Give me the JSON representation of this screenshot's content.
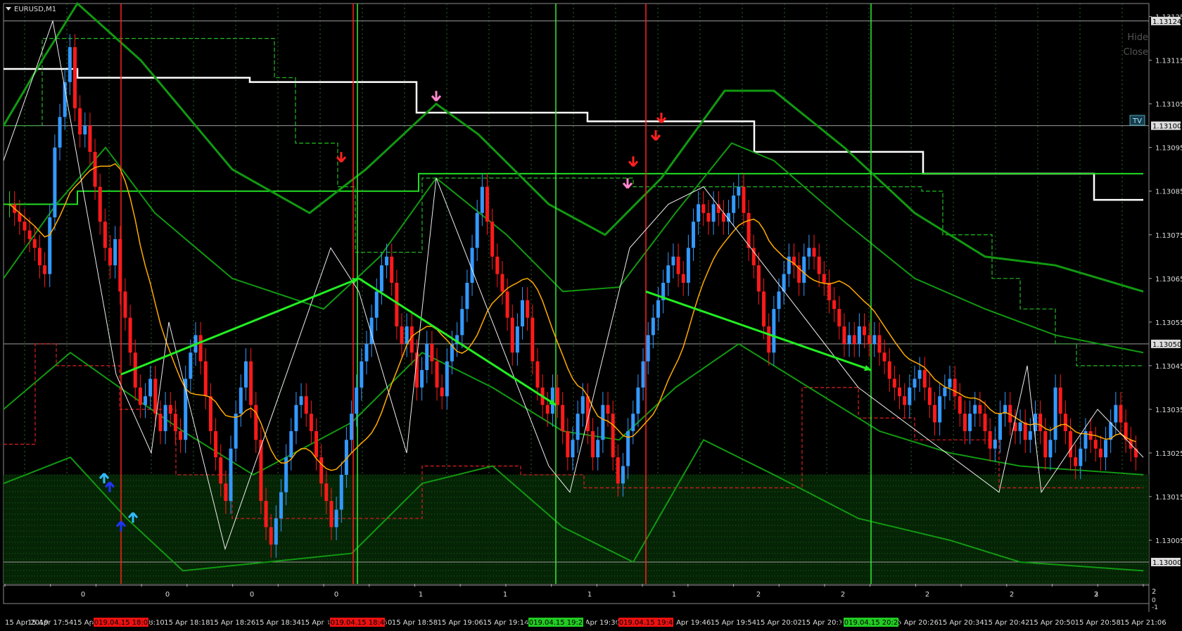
{
  "chart": {
    "symbol_title": "EURUSD,M1",
    "hide_label": "Hide",
    "close_label": "Close",
    "tv_label": "TV"
  },
  "colors": {
    "bull": "#3399ff",
    "bear": "#ff1a1a",
    "doji": "#33cc33",
    "ma": "#ffaa00",
    "trend_arrow": "#22ee22",
    "band_green": "#119911",
    "step_white": "#ffffff",
    "step_green": "#22dd22",
    "red_line": "#ff2020",
    "axis_text": "#dddddd"
  },
  "chart_data": {
    "type": "candlestick",
    "symbol": "EURUSD",
    "timeframe": "M1",
    "ylim": [
      1.12995,
      1.13128
    ],
    "yticks": [
      "1.13125",
      "1.13115",
      "1.13105",
      "1.13095",
      "1.13085",
      "1.13075",
      "1.13065",
      "1.13055",
      "1.13045",
      "1.13035",
      "1.13025",
      "1.13015",
      "1.13005"
    ],
    "price_tags": [
      "1.13124",
      "1.13100",
      "1.13050",
      "1.13000"
    ],
    "x_labels": [
      "15 Apr 2019",
      "15 Apr 17:54",
      "15 Apr 18:02",
      "15 Apr 18:10",
      "15 Apr 18:18",
      "15 Apr 18:26",
      "15 Apr 18:34",
      "15 Apr 18:42",
      "15 Apr 18:50",
      "15 Apr 18:58",
      "15 Apr 19:06",
      "15 Apr 19:14",
      "15 Apr 19:22",
      "15 Apr 19:30",
      "15 Apr 19:38",
      "15 Apr 19:46",
      "15 Apr 19:54",
      "15 Apr 20:02",
      "15 Apr 20:10",
      "15 Apr 20:18",
      "15 Apr 20:26",
      "15 Apr 20:34",
      "15 Apr 20:42",
      "15 Apr 20:50",
      "15 Apr 20:58",
      "15 Apr 21:06"
    ],
    "time_markers": [
      {
        "label": "2019.04.15 18:07",
        "color": "red"
      },
      {
        "label": "2019.04.15 18:49",
        "color": "red"
      },
      {
        "label": "2019.04.15 19:24",
        "color": "green"
      },
      {
        "label": "2019.04.15 19:40",
        "color": "red"
      },
      {
        "label": "2019.04.15 20:20",
        "color": "green"
      }
    ],
    "subwindow": {
      "counts": [
        "0",
        "0",
        "0",
        "0",
        "1",
        "1",
        "1",
        "1",
        "2",
        "2",
        "2",
        "2",
        "2",
        "3"
      ],
      "axis_labels": [
        "2",
        "0",
        "-1"
      ]
    },
    "close": [
      1.13082,
      1.1308,
      1.13078,
      1.13076,
      1.13074,
      1.13072,
      1.13068,
      1.13066,
      1.13079,
      1.13095,
      1.13102,
      1.1311,
      1.13118,
      1.13104,
      1.13098,
      1.131,
      1.13094,
      1.13086,
      1.13078,
      1.13072,
      1.13068,
      1.13074,
      1.13062,
      1.13056,
      1.13048,
      1.1304,
      1.13036,
      1.13038,
      1.13042,
      1.13034,
      1.1303,
      1.13036,
      1.13034,
      1.1303,
      1.13028,
      1.13042,
      1.13048,
      1.13052,
      1.13046,
      1.13038,
      1.1303,
      1.13024,
      1.13018,
      1.13014,
      1.13026,
      1.13034,
      1.1304,
      1.13046,
      1.13036,
      1.13028,
      1.13014,
      1.13008,
      1.13004,
      1.1301,
      1.13016,
      1.13024,
      1.1303,
      1.13036,
      1.13038,
      1.13034,
      1.1303,
      1.13024,
      1.13018,
      1.13014,
      1.13008,
      1.13012,
      1.1302,
      1.13028,
      1.13034,
      1.1304,
      1.13046,
      1.1305,
      1.13056,
      1.13062,
      1.13068,
      1.1307,
      1.13064,
      1.13054,
      1.1305,
      1.13054,
      1.13048,
      1.1304,
      1.13044,
      1.1305,
      1.13046,
      1.1304,
      1.13038,
      1.13046,
      1.1305,
      1.13052,
      1.13058,
      1.13064,
      1.13072,
      1.1308,
      1.13086,
      1.13078,
      1.1307,
      1.13066,
      1.13062,
      1.13056,
      1.13048,
      1.13054,
      1.1306,
      1.13056,
      1.13046,
      1.1304,
      1.13036,
      1.13034,
      1.1304,
      1.13036,
      1.1303,
      1.13024,
      1.13028,
      1.13034,
      1.13038,
      1.1303,
      1.13024,
      1.13028,
      1.13036,
      1.13034,
      1.13024,
      1.13018,
      1.13022,
      1.1303,
      1.13034,
      1.1304,
      1.13046,
      1.13052,
      1.13056,
      1.1306,
      1.13064,
      1.13068,
      1.1307,
      1.13066,
      1.13064,
      1.13072,
      1.13078,
      1.13082,
      1.1308,
      1.13078,
      1.13082,
      1.1308,
      1.13078,
      1.1308,
      1.13084,
      1.13086,
      1.1308,
      1.13072,
      1.13068,
      1.13062,
      1.13054,
      1.13048,
      1.13058,
      1.13062,
      1.13066,
      1.1307,
      1.13068,
      1.13064,
      1.1307,
      1.13072,
      1.1307,
      1.13066,
      1.13064,
      1.1306,
      1.13058,
      1.13054,
      1.1305,
      1.13052,
      1.1305,
      1.13054,
      1.13052,
      1.1305,
      1.13052,
      1.13048,
      1.13046,
      1.13042,
      1.1304,
      1.13038,
      1.13036,
      1.1304,
      1.13042,
      1.13044,
      1.1304,
      1.13036,
      1.13032,
      1.13038,
      1.1304,
      1.13042,
      1.13038,
      1.13034,
      1.1303,
      1.13034,
      1.13036,
      1.13034,
      1.1303,
      1.13026,
      1.13028,
      1.13034,
      1.13036,
      1.13032,
      1.1303,
      1.13032,
      1.13028,
      1.1303,
      1.13034,
      1.1303,
      1.13024,
      1.13028,
      1.1304,
      1.13034,
      1.1303,
      1.13024,
      1.13022,
      1.13026,
      1.1303,
      1.13028,
      1.13026,
      1.13024,
      1.13028,
      1.13032,
      1.13036,
      1.13032,
      1.13028,
      1.13026,
      1.13024
    ]
  }
}
